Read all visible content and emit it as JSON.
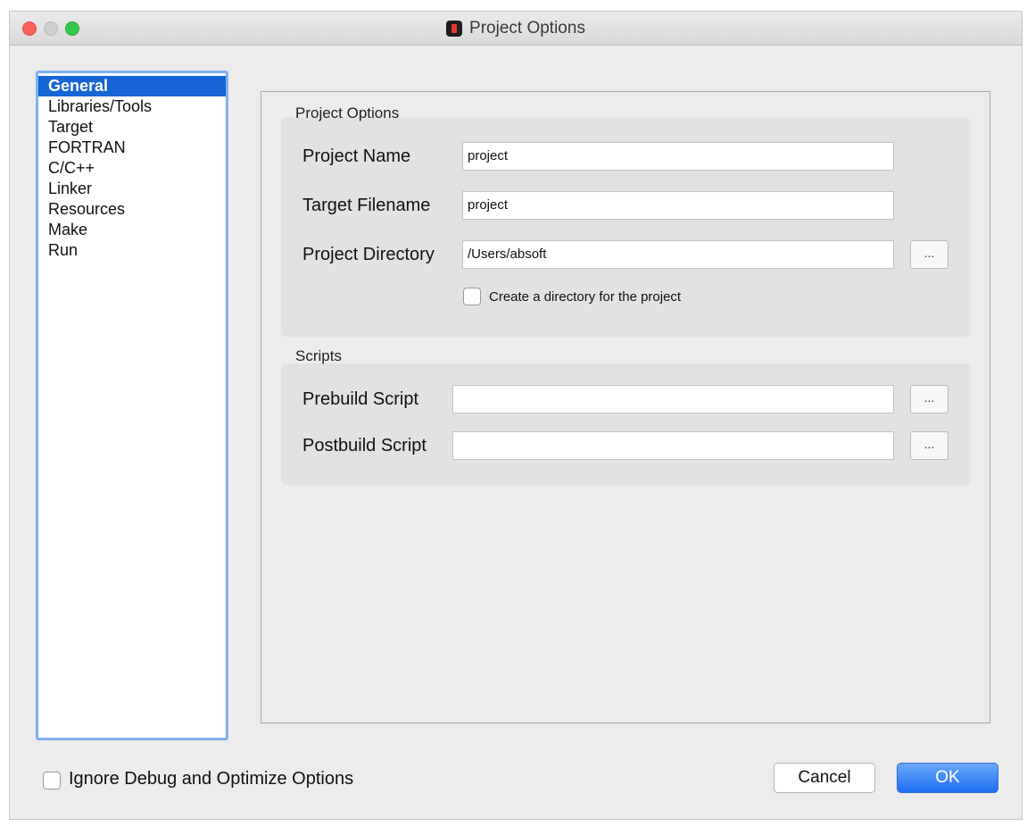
{
  "window": {
    "title": "Project Options"
  },
  "sidebar": {
    "items": [
      {
        "label": "General",
        "selected": true
      },
      {
        "label": "Libraries/Tools"
      },
      {
        "label": "Target"
      },
      {
        "label": "FORTRAN"
      },
      {
        "label": "C/C++"
      },
      {
        "label": "Linker"
      },
      {
        "label": "Resources"
      },
      {
        "label": "Make"
      },
      {
        "label": "Run"
      }
    ]
  },
  "project_options": {
    "title": "Project Options",
    "project_name_label": "Project Name",
    "project_name_value": "project",
    "target_filename_label": "Target Filename",
    "target_filename_value": "project",
    "project_directory_label": "Project Directory",
    "project_directory_value": "/Users/absoft",
    "browse_label": "...",
    "create_dir_label": "Create a directory for the project",
    "create_dir_checked": false
  },
  "scripts": {
    "title": "Scripts",
    "prebuild_label": "Prebuild Script",
    "prebuild_value": "",
    "postbuild_label": "Postbuild Script",
    "postbuild_value": "",
    "browse_label": "..."
  },
  "footer": {
    "ignore_label": "Ignore Debug and Optimize Options",
    "ignore_checked": false,
    "cancel_label": "Cancel",
    "ok_label": "OK"
  },
  "colors": {
    "selection": "#1865d6",
    "ok_button": "#1d6df1",
    "close_light": "#fc605b",
    "maximize_light": "#34c84a"
  }
}
